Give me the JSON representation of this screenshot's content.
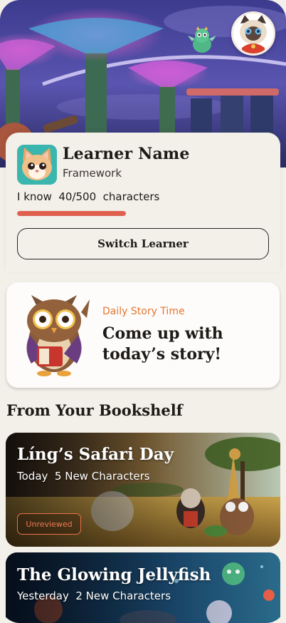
{
  "learner": {
    "name": "Learner Name",
    "subtitle": "Framework",
    "progress_label": "I know  40/500  characters",
    "known": 40,
    "total": 500,
    "switch_label": "Switch Learner"
  },
  "daily": {
    "kicker": "Daily Story Time",
    "title": "Come up with today’s story!"
  },
  "bookshelf": {
    "heading": "From Your Bookshelf",
    "books": [
      {
        "title": "Líng’s Safari Day",
        "meta": "Today  5 New Characters",
        "badge": "Unreviewed"
      },
      {
        "title": "The Glowing Jellyfish",
        "meta": "Yesterday  2 New Characters"
      }
    ]
  },
  "colors": {
    "accent_orange": "#e4762f",
    "progress_red": "#e06050",
    "background": "#f3efe9"
  },
  "icons": [
    "cat-avatar-icon",
    "owl-icon",
    "dragon-icon",
    "profile-avatar-icon"
  ]
}
